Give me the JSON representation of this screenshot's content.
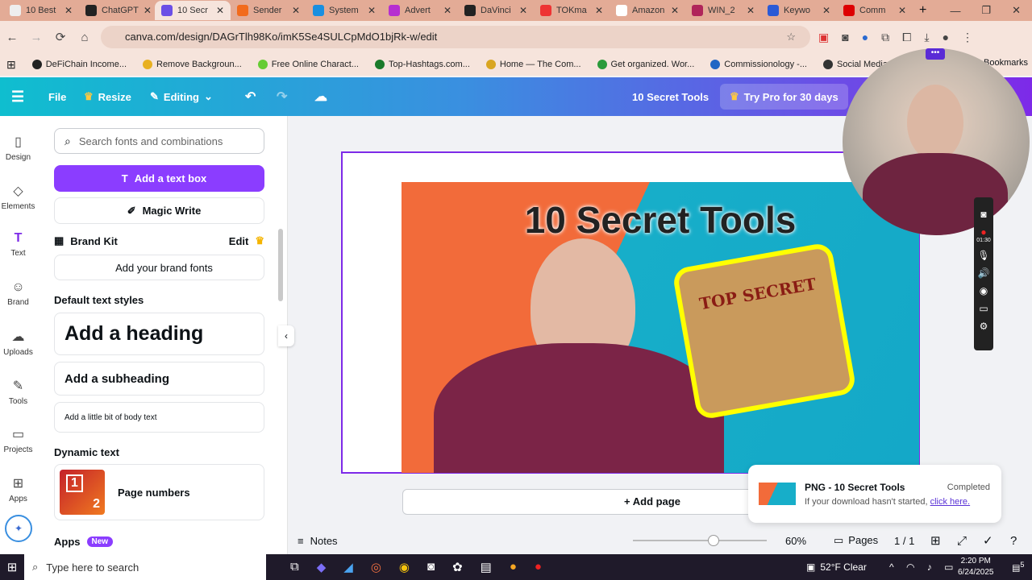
{
  "browser": {
    "tabs": [
      {
        "label": "10 Best",
        "color": "#eee"
      },
      {
        "label": "ChatGPT",
        "color": "#222"
      },
      {
        "label": "10 Secr",
        "color": "#6b4fe6",
        "active": true
      },
      {
        "label": "Sender",
        "color": "#f26b1d"
      },
      {
        "label": "System",
        "color": "#1a8fe0"
      },
      {
        "label": "Advert",
        "color": "#b62fd0"
      },
      {
        "label": "DaVinci",
        "color": "#222"
      },
      {
        "label": "TOKma",
        "color": "#e33"
      },
      {
        "label": "Amazon",
        "color": "#fff"
      },
      {
        "label": "WIN_2",
        "color": "#b0255a"
      },
      {
        "label": "Keywo",
        "color": "#2b5ad6"
      },
      {
        "label": "Comm",
        "color": "#d00"
      }
    ],
    "url": "canva.com/design/DAGrTlh98Ko/imK5Se4SULCpMdO1bjRk-w/edit",
    "bookmarks": [
      {
        "label": "DeFiChain Income...",
        "color": "#222"
      },
      {
        "label": "Remove Backgroun...",
        "color": "#e8b020"
      },
      {
        "label": "Free Online Charact...",
        "color": "#6c3"
      },
      {
        "label": "Top-Hashtags.com...",
        "color": "#1a7a2a"
      },
      {
        "label": "Home — The Com...",
        "color": "#d9a520"
      },
      {
        "label": "Get organized. Wor...",
        "color": "#2a9a3a"
      },
      {
        "label": "Commissionology -...",
        "color": "#2166c4"
      },
      {
        "label": "Social Media Monit...",
        "color": "#333"
      }
    ],
    "bookmarks_all": "Bookmarks"
  },
  "header": {
    "file": "File",
    "resize": "Resize",
    "editing": "Editing",
    "title": "10 Secret Tools",
    "try_pro": "Try Pro for 30 days"
  },
  "rail": [
    {
      "label": "Design",
      "icon": "▯"
    },
    {
      "label": "Elements",
      "icon": "◇"
    },
    {
      "label": "Text",
      "icon": "T"
    },
    {
      "label": "Brand",
      "icon": "☺"
    },
    {
      "label": "Uploads",
      "icon": "☁"
    },
    {
      "label": "Tools",
      "icon": "✎"
    },
    {
      "label": "Projects",
      "icon": "▭"
    },
    {
      "label": "Apps",
      "icon": "⊞"
    }
  ],
  "panel": {
    "search_placeholder": "Search fonts and combinations",
    "add_text_box": "Add a text box",
    "magic_write": "Magic Write",
    "brand_kit": "Brand Kit",
    "brand_edit": "Edit",
    "add_brand_fonts": "Add your brand fonts",
    "default_styles": "Default text styles",
    "heading": "Add a heading",
    "subheading": "Add a subheading",
    "body": "Add a little bit of body text",
    "dynamic_text": "Dynamic text",
    "page_numbers": "Page numbers",
    "apps": "Apps",
    "new_badge": "New"
  },
  "design": {
    "title": "10 Secret Tools",
    "scroll_text": "TOP SECRET"
  },
  "add_page": "+ Add page",
  "toast": {
    "title": "PNG - 10 Secret Tools",
    "status": "Completed",
    "msg": "If your download hasn't started,",
    "link": "click here."
  },
  "bottom": {
    "notes": "Notes",
    "zoom": "60%",
    "zoom_fraction": 0.6,
    "pages": "Pages",
    "page_count": "1 / 1"
  },
  "taskbar": {
    "search": "Type here to search",
    "weather": "52°F  Clear",
    "time": "2:20 PM",
    "date": "6/24/2025",
    "notif": "5"
  },
  "recorder": {
    "time": "01:30"
  }
}
